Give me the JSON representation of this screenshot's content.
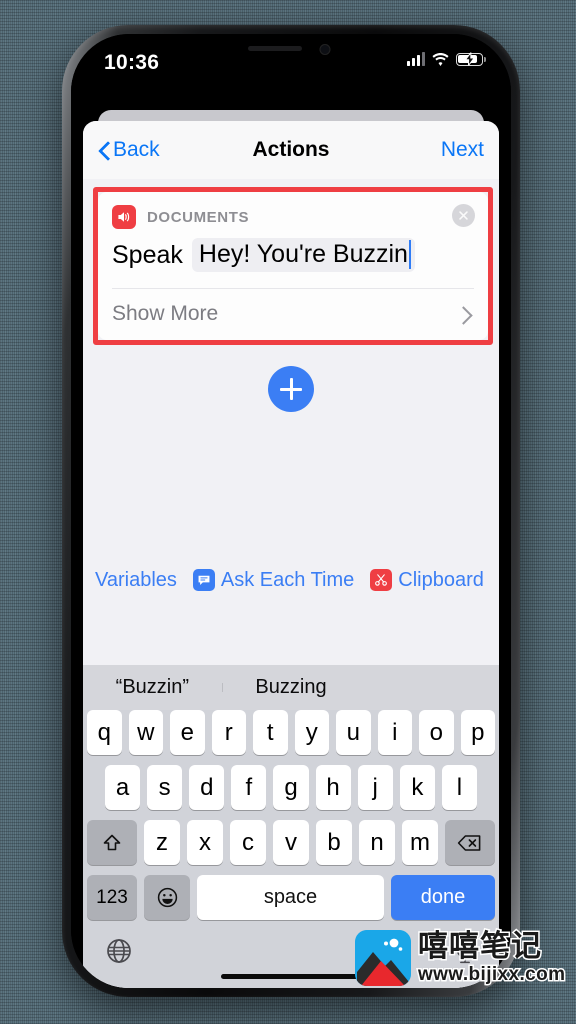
{
  "status_bar": {
    "time": "10:36",
    "signal_icon": "cellular-bars-icon",
    "wifi_icon": "wifi-icon",
    "battery_icon": "battery-charging-icon"
  },
  "nav": {
    "back_label": "Back",
    "title": "Actions",
    "next_label": "Next"
  },
  "card": {
    "category": "DOCUMENTS",
    "app_icon": "speaker-volume-icon",
    "close_icon": "close-circle-icon",
    "action_label": "Speak",
    "text_value": "Hey! You're Buzzin",
    "show_more_label": "Show More",
    "chevron_icon": "chevron-right-icon",
    "highlight_color": "#ef3e43"
  },
  "add_button": {
    "icon": "plus-icon",
    "color": "#3b7ef4"
  },
  "variables_bar": {
    "items": [
      {
        "label": "Variables",
        "icon": null
      },
      {
        "label": "Ask Each Time",
        "icon": "speech-bubble-icon"
      },
      {
        "label": "Clipboard",
        "icon": "scissors-icon"
      },
      {
        "label": "",
        "icon": "calendar-icon"
      }
    ]
  },
  "keyboard": {
    "predictions": [
      "“Buzzin”",
      "Buzzing",
      ""
    ],
    "row1": [
      "q",
      "w",
      "e",
      "r",
      "t",
      "y",
      "u",
      "i",
      "o",
      "p"
    ],
    "row2": [
      "a",
      "s",
      "d",
      "f",
      "g",
      "h",
      "j",
      "k",
      "l"
    ],
    "row3": [
      "z",
      "x",
      "c",
      "v",
      "b",
      "n",
      "m"
    ],
    "shift_icon": "shift-up-arrow-icon",
    "backspace_icon": "backspace-delete-icon",
    "numbers_label": "123",
    "emoji_icon": "smiley-face-icon",
    "space_label": "space",
    "done_label": "done",
    "globe_icon": "globe-language-icon",
    "mic_icon": "microphone-dictation-icon"
  },
  "watermark": {
    "title": "嘻嘻笔记",
    "url": "www.bijixx.com",
    "logo_icon": "mountain-photo-logo"
  }
}
